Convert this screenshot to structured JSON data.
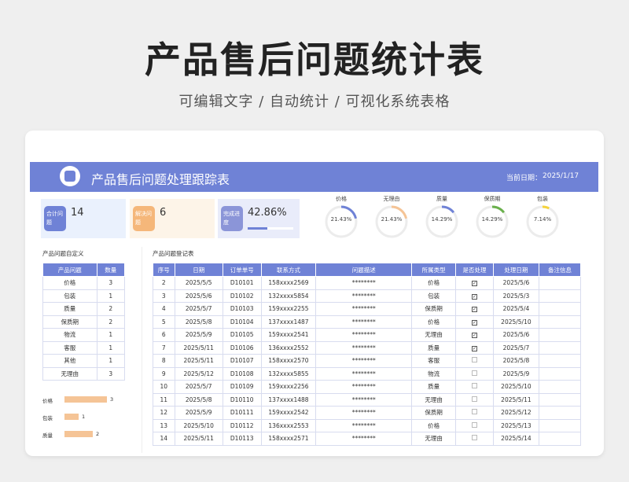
{
  "hero": {
    "title": "产品售后问题统计表",
    "subtitle": "可编辑文字 / 自动统计 / 可视化系统表格"
  },
  "sheet": {
    "title": "产品售后问题处理跟踪表",
    "date_label": "当前日期：",
    "date": "2025/1/17",
    "accent": "#6f82d6"
  },
  "kpis": [
    {
      "badge": "合计问题",
      "value": "14",
      "bg": "#eaf1fd",
      "badge_color": "#6f82d6"
    },
    {
      "badge": "解决问题",
      "value": "6",
      "bg": "#fdf4e8",
      "badge_color": "#f5b77a"
    },
    {
      "badge": "完成进度",
      "value": "42.86%",
      "bg": "#e9ecfa",
      "badge_color": "#8b95d8",
      "progress": 0.4286
    }
  ],
  "donuts": [
    {
      "label": "价格",
      "pct": "21.43%",
      "value": 0.2143,
      "color": "#6f82d6"
    },
    {
      "label": "无理由",
      "pct": "21.43%",
      "value": 0.2143,
      "color": "#f5c496"
    },
    {
      "label": "质量",
      "pct": "14.29%",
      "value": 0.1429,
      "color": "#6f82d6"
    },
    {
      "label": "保质期",
      "pct": "14.29%",
      "value": 0.1429,
      "color": "#6ab04c"
    },
    {
      "label": "包装",
      "pct": "7.14%",
      "value": 0.0714,
      "color": "#f5d33c"
    }
  ],
  "categories": {
    "title": "产品问题自定义",
    "headers": [
      "产品问题",
      "数量"
    ],
    "rows": [
      [
        "价格",
        "3"
      ],
      [
        "包装",
        "1"
      ],
      [
        "质量",
        "2"
      ],
      [
        "保质期",
        "2"
      ],
      [
        "物流",
        "1"
      ],
      [
        "客服",
        "1"
      ],
      [
        "其他",
        "1"
      ],
      [
        "无理由",
        "3"
      ]
    ]
  },
  "minibars": [
    {
      "label": "价格",
      "num": "3",
      "value": 3
    },
    {
      "label": "包装",
      "num": "1",
      "value": 1
    },
    {
      "label": "质量",
      "num": "2",
      "value": 2
    }
  ],
  "log": {
    "title": "产品问题登记表",
    "headers": [
      "序号",
      "日期",
      "订单单号",
      "联系方式",
      "问题描述",
      "所属类型",
      "是否处理",
      "处理日期",
      "备注信息"
    ],
    "rows": [
      [
        "2",
        "2025/5/5",
        "D10101",
        "158xxxx2569",
        "********",
        "价格",
        "1",
        "2025/5/6",
        ""
      ],
      [
        "3",
        "2025/5/6",
        "D10102",
        "132xxxx5854",
        "********",
        "包装",
        "1",
        "2025/5/3",
        ""
      ],
      [
        "4",
        "2025/5/7",
        "D10103",
        "159xxxx2255",
        "********",
        "保质期",
        "1",
        "2025/5/4",
        ""
      ],
      [
        "5",
        "2025/5/8",
        "D10104",
        "137xxxx1487",
        "********",
        "价格",
        "1",
        "2025/5/10",
        ""
      ],
      [
        "6",
        "2025/5/9",
        "D10105",
        "159xxxx2541",
        "********",
        "无理由",
        "1",
        "2025/5/6",
        ""
      ],
      [
        "7",
        "2025/5/11",
        "D10106",
        "136xxxx2552",
        "********",
        "质量",
        "1",
        "2025/5/7",
        ""
      ],
      [
        "8",
        "2025/5/11",
        "D10107",
        "158xxxx2570",
        "********",
        "客服",
        "0",
        "2025/5/8",
        ""
      ],
      [
        "9",
        "2025/5/12",
        "D10108",
        "132xxxx5855",
        "********",
        "物流",
        "0",
        "2025/5/9",
        ""
      ],
      [
        "10",
        "2025/5/7",
        "D10109",
        "159xxxx2256",
        "********",
        "质量",
        "0",
        "2025/5/10",
        ""
      ],
      [
        "11",
        "2025/5/8",
        "D10110",
        "137xxxx1488",
        "********",
        "无理由",
        "0",
        "2025/5/11",
        ""
      ],
      [
        "12",
        "2025/5/9",
        "D10111",
        "159xxxx2542",
        "********",
        "保质期",
        "0",
        "2025/5/12",
        ""
      ],
      [
        "13",
        "2025/5/10",
        "D10112",
        "136xxxx2553",
        "********",
        "价格",
        "0",
        "2025/5/13",
        ""
      ],
      [
        "14",
        "2025/5/11",
        "D10113",
        "158xxxx2571",
        "********",
        "无理由",
        "0",
        "2025/5/14",
        ""
      ]
    ]
  }
}
